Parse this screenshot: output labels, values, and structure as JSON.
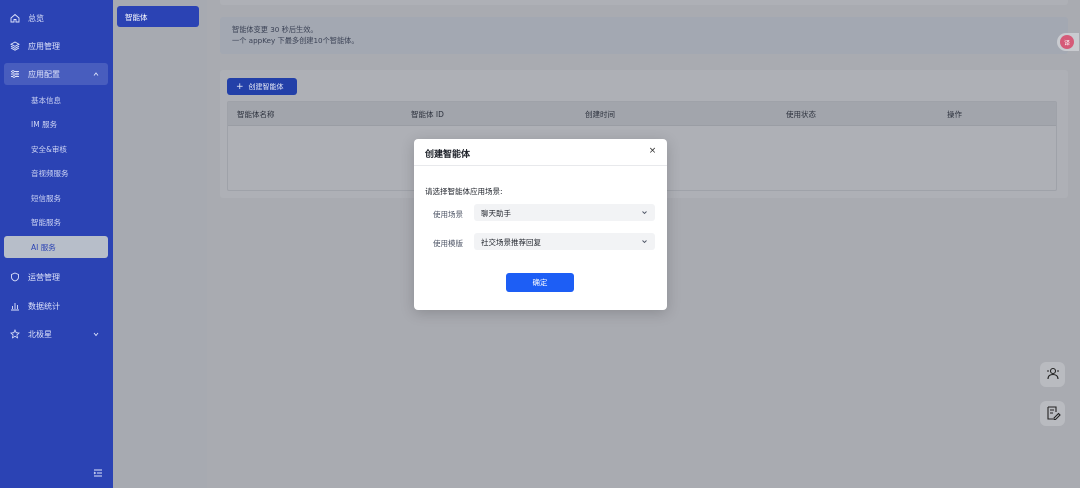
{
  "sidebar": {
    "items": [
      {
        "label": "总览",
        "icon": "home-icon"
      },
      {
        "label": "应用管理",
        "icon": "layers-icon"
      },
      {
        "label": "应用配置",
        "icon": "sliders-icon"
      },
      {
        "label": "运营管理",
        "icon": "shield-icon"
      },
      {
        "label": "数据统计",
        "icon": "chart-icon"
      },
      {
        "label": "北极星",
        "icon": "star-icon"
      }
    ],
    "sub_items": [
      "基本信息",
      "IM 服务",
      "安全&审核",
      "音视频服务",
      "短信服务",
      "智能服务",
      "AI 服务"
    ]
  },
  "column2": {
    "active_item": "智能体"
  },
  "notice": {
    "line1": "智能体变更 30 秒后生效。",
    "line2": "一个 appKey 下最多创建10个智能体。"
  },
  "toolbar": {
    "create_label": "创建智能体"
  },
  "table": {
    "headers": [
      "智能体名称",
      "智能体 ID",
      "创建时间",
      "使用状态",
      "操作"
    ]
  },
  "modal": {
    "title": "创建智能体",
    "close": "×",
    "prompt": "请选择智能体应用场景:",
    "scene_label": "使用场景",
    "scene_value": "聊天助手",
    "template_label": "使用模版",
    "template_value": "社交场景推荐回复",
    "confirm_label": "确定"
  },
  "floating": {
    "badge_text": "译"
  },
  "colors": {
    "sidebar_bg": "#2b43b4",
    "primary": "#1d5ef5"
  }
}
